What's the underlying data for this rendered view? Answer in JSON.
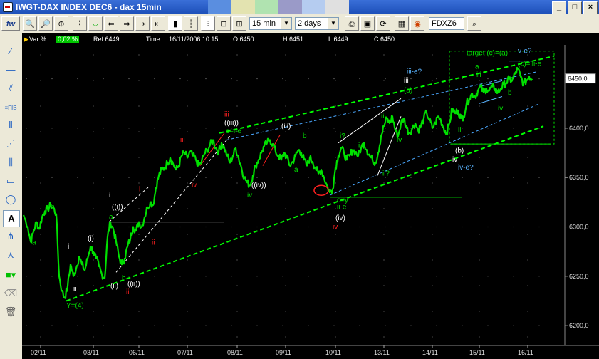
{
  "window": {
    "title": "IWGT-DAX INDEX DEC6 - dax 15min"
  },
  "title_swatches": [
    "#5a8ee0",
    "#e3e3b0",
    "#b0e3b0",
    "#9a9ac8",
    "#b5ccf0",
    "#e0e0e0"
  ],
  "toolbar": {
    "interval": "15 min",
    "range": "2 days",
    "symbol": "FDXZ6",
    "fw_label": "fw"
  },
  "infobar": {
    "var_label": "Var %:",
    "var_value": "0,02 %",
    "ref_label": "Ref:6449",
    "time_label": "Time:",
    "time_value": "16/11/2006 10:15",
    "open": "O:6450",
    "high": "H:6451",
    "low": "L:6449",
    "close": "C:6450"
  },
  "chart_data": {
    "type": "line",
    "instrument": "DAX INDEX DEC6 15min",
    "yticks": [
      "6200,0",
      "6250,0",
      "6300,0",
      "6350,0",
      "6400,0",
      "6450,0"
    ],
    "ytick_values": [
      6200,
      6250,
      6300,
      6350,
      6400,
      6450
    ],
    "ylim": [
      6190,
      6480
    ],
    "xticks": [
      "02/11",
      "03/11",
      "06/11",
      "07/11",
      "08/11",
      "09/11",
      "10/11",
      "13/11",
      "14/11",
      "15/11",
      "16/11"
    ],
    "last_value": "6450,0",
    "series_color": "#00e000",
    "price_path": [
      [
        0,
        6312
      ],
      [
        6,
        6300
      ],
      [
        10,
        6285
      ],
      [
        14,
        6295
      ],
      [
        18,
        6305
      ],
      [
        22,
        6298
      ],
      [
        26,
        6310
      ],
      [
        30,
        6316
      ],
      [
        34,
        6318
      ],
      [
        38,
        6322
      ],
      [
        42,
        6319
      ],
      [
        46,
        6313
      ],
      [
        50,
        6250
      ],
      [
        54,
        6235
      ],
      [
        58,
        6228
      ],
      [
        62,
        6240
      ],
      [
        66,
        6262
      ],
      [
        70,
        6250
      ],
      [
        74,
        6258
      ],
      [
        78,
        6270
      ],
      [
        82,
        6262
      ],
      [
        86,
        6256
      ],
      [
        90,
        6268
      ],
      [
        94,
        6280
      ],
      [
        98,
        6275
      ],
      [
        102,
        6268
      ],
      [
        106,
        6260
      ],
      [
        110,
        6252
      ],
      [
        114,
        6248
      ],
      [
        118,
        6290
      ],
      [
        122,
        6305
      ],
      [
        126,
        6298
      ],
      [
        130,
        6285
      ],
      [
        134,
        6270
      ],
      [
        138,
        6262
      ],
      [
        142,
        6268
      ],
      [
        146,
        6280
      ],
      [
        150,
        6288
      ],
      [
        154,
        6300
      ],
      [
        158,
        6296
      ],
      [
        162,
        6305
      ],
      [
        166,
        6300
      ],
      [
        170,
        6310
      ],
      [
        174,
        6320
      ],
      [
        178,
        6325
      ],
      [
        182,
        6322
      ],
      [
        186,
        6340
      ],
      [
        190,
        6352
      ],
      [
        194,
        6358
      ],
      [
        198,
        6360
      ],
      [
        202,
        6365
      ],
      [
        206,
        6370
      ],
      [
        210,
        6364
      ],
      [
        214,
        6358
      ],
      [
        218,
        6362
      ],
      [
        222,
        6372
      ],
      [
        226,
        6375
      ],
      [
        230,
        6370
      ],
      [
        234,
        6376
      ],
      [
        238,
        6372
      ],
      [
        242,
        6368
      ],
      [
        246,
        6362
      ],
      [
        250,
        6366
      ],
      [
        254,
        6374
      ],
      [
        258,
        6378
      ],
      [
        262,
        6383
      ],
      [
        266,
        6388
      ],
      [
        270,
        6380
      ],
      [
        274,
        6376
      ],
      [
        278,
        6385
      ],
      [
        282,
        6380
      ],
      [
        286,
        6372
      ],
      [
        290,
        6365
      ],
      [
        294,
        6372
      ],
      [
        298,
        6380
      ],
      [
        302,
        6370
      ],
      [
        306,
        6360
      ],
      [
        310,
        6350
      ],
      [
        314,
        6345
      ],
      [
        318,
        6342
      ],
      [
        322,
        6352
      ],
      [
        326,
        6362
      ],
      [
        330,
        6368
      ],
      [
        334,
        6375
      ],
      [
        338,
        6382
      ],
      [
        342,
        6385
      ],
      [
        346,
        6388
      ],
      [
        350,
        6384
      ],
      [
        354,
        6376
      ],
      [
        358,
        6372
      ],
      [
        362,
        6368
      ],
      [
        366,
        6375
      ],
      [
        370,
        6370
      ],
      [
        374,
        6362
      ],
      [
        378,
        6366
      ],
      [
        382,
        6372
      ],
      [
        386,
        6378
      ],
      [
        390,
        6375
      ],
      [
        394,
        6368
      ],
      [
        398,
        6362
      ],
      [
        402,
        6370
      ],
      [
        406,
        6366
      ],
      [
        410,
        6360
      ],
      [
        414,
        6354
      ],
      [
        418,
        6358
      ],
      [
        422,
        6350
      ],
      [
        426,
        6342
      ],
      [
        430,
        6335
      ],
      [
        434,
        6338
      ],
      [
        438,
        6360
      ],
      [
        442,
        6372
      ],
      [
        446,
        6380
      ],
      [
        450,
        6375
      ],
      [
        454,
        6368
      ],
      [
        458,
        6372
      ],
      [
        462,
        6378
      ],
      [
        466,
        6376
      ],
      [
        470,
        6372
      ],
      [
        474,
        6380
      ],
      [
        478,
        6385
      ],
      [
        482,
        6378
      ],
      [
        486,
        6372
      ],
      [
        490,
        6368
      ],
      [
        494,
        6365
      ],
      [
        498,
        6375
      ],
      [
        502,
        6392
      ],
      [
        506,
        6402
      ],
      [
        510,
        6410
      ],
      [
        514,
        6405
      ],
      [
        518,
        6412
      ],
      [
        522,
        6398
      ],
      [
        526,
        6392
      ],
      [
        530,
        6405
      ],
      [
        534,
        6410
      ],
      [
        538,
        6400
      ],
      [
        542,
        6395
      ],
      [
        546,
        6400
      ],
      [
        550,
        6405
      ],
      [
        554,
        6398
      ],
      [
        558,
        6402
      ],
      [
        562,
        6410
      ],
      [
        566,
        6416
      ],
      [
        570,
        6408
      ],
      [
        574,
        6400
      ],
      [
        578,
        6405
      ],
      [
        582,
        6412
      ],
      [
        586,
        6408
      ],
      [
        590,
        6400
      ],
      [
        594,
        6395
      ],
      [
        598,
        6405
      ],
      [
        602,
        6420
      ],
      [
        606,
        6415
      ],
      [
        610,
        6418
      ],
      [
        614,
        6410
      ],
      [
        618,
        6412
      ],
      [
        622,
        6425
      ],
      [
        626,
        6430
      ],
      [
        630,
        6435
      ],
      [
        634,
        6432
      ],
      [
        638,
        6438
      ],
      [
        642,
        6442
      ],
      [
        646,
        6436
      ],
      [
        650,
        6440
      ],
      [
        654,
        6438
      ],
      [
        658,
        6442
      ],
      [
        662,
        6440
      ],
      [
        666,
        6436
      ],
      [
        670,
        6440
      ],
      [
        674,
        6444
      ],
      [
        678,
        6446
      ],
      [
        682,
        6450
      ],
      [
        686,
        6448
      ],
      [
        690,
        6455
      ],
      [
        694,
        6460
      ],
      [
        698,
        6452
      ],
      [
        702,
        6445
      ],
      [
        706,
        6448
      ],
      [
        710,
        6452
      ],
      [
        714,
        6450
      ]
    ],
    "annotations": [
      {
        "text": "b",
        "color": "#00e000",
        "x": 38,
        "y": 6318
      },
      {
        "text": "a",
        "color": "#00e000",
        "x": 12,
        "y": 6282
      },
      {
        "text": "i",
        "color": "#ffffff",
        "x": 62,
        "y": 6278
      },
      {
        "text": "ii",
        "color": "#ffffff",
        "x": 70,
        "y": 6235
      },
      {
        "text": "Y=(4)",
        "color": "#00e000",
        "x": 60,
        "y": 6218
      },
      {
        "text": "(i)",
        "color": "#ffffff",
        "x": 90,
        "y": 6286
      },
      {
        "text": "(ii)",
        "color": "#ffffff",
        "x": 122,
        "y": 6238
      },
      {
        "text": "i",
        "color": "#ffffff",
        "x": 120,
        "y": 6330
      },
      {
        "text": "((i))",
        "color": "#ffffff",
        "x": 124,
        "y": 6318
      },
      {
        "text": "a",
        "color": "#00e000",
        "x": 120,
        "y": 6308
      },
      {
        "text": "ii",
        "color": "#ff2020",
        "x": 180,
        "y": 6282
      },
      {
        "text": "i",
        "color": "#ff2020",
        "x": 162,
        "y": 6336
      },
      {
        "text": "((ii))",
        "color": "#ffffff",
        "x": 146,
        "y": 6240
      },
      {
        "text": "b",
        "color": "#00e000",
        "x": 138,
        "y": 6246
      },
      {
        "text": "ii",
        "color": "#ff2020",
        "x": 144,
        "y": 6232
      },
      {
        "text": "iii",
        "color": "#ff2020",
        "x": 220,
        "y": 6386
      },
      {
        "text": "iv",
        "color": "#ff2020",
        "x": 236,
        "y": 6340
      },
      {
        "text": "iii",
        "color": "#ff2020",
        "x": 282,
        "y": 6412
      },
      {
        "text": "((iii))",
        "color": "#ffffff",
        "x": 282,
        "y": 6403
      },
      {
        "text": "c=i-e",
        "color": "#00e000",
        "x": 284,
        "y": 6395
      },
      {
        "text": "((iv))",
        "color": "#ffffff",
        "x": 320,
        "y": 6340
      },
      {
        "text": "iv",
        "color": "#00e000",
        "x": 314,
        "y": 6330
      },
      {
        "text": "(iii)",
        "color": "#ffffff",
        "x": 362,
        "y": 6400
      },
      {
        "text": "b",
        "color": "#00e000",
        "x": 392,
        "y": 6390
      },
      {
        "text": "a",
        "color": "#00e000",
        "x": 380,
        "y": 6356
      },
      {
        "text": "i?",
        "color": "#00e000",
        "x": 444,
        "y": 6390
      },
      {
        "text": "c=y",
        "color": "#00e000",
        "x": 440,
        "y": 6325
      },
      {
        "text": "ii-e",
        "color": "#00e000",
        "x": 440,
        "y": 6318
      },
      {
        "text": "(iv)",
        "color": "#ffffff",
        "x": 438,
        "y": 6307
      },
      {
        "text": "iv",
        "color": "#ff2020",
        "x": 434,
        "y": 6298
      },
      {
        "text": "i",
        "color": "#00e000",
        "x": 470,
        "y": 6380
      },
      {
        "text": "ii?",
        "color": "#00e000",
        "x": 504,
        "y": 6352
      },
      {
        "text": "iii",
        "color": "#00e000",
        "x": 502,
        "y": 6410
      },
      {
        "text": "iii-e?",
        "color": "#5ab4ff",
        "x": 538,
        "y": 6455
      },
      {
        "text": "iii",
        "color": "#ffffff",
        "x": 534,
        "y": 6446
      },
      {
        "text": "(a)",
        "color": "#00e000",
        "x": 534,
        "y": 6436
      },
      {
        "text": "iv",
        "color": "#00e000",
        "x": 524,
        "y": 6386
      },
      {
        "text": "ii",
        "color": "#00e000",
        "x": 610,
        "y": 6396
      },
      {
        "text": "(b)",
        "color": "#ffffff",
        "x": 606,
        "y": 6375
      },
      {
        "text": "iv",
        "color": "#ffffff",
        "x": 602,
        "y": 6366
      },
      {
        "text": "iv-e?",
        "color": "#5ab4ff",
        "x": 610,
        "y": 6358
      },
      {
        "text": "a",
        "color": "#00e000",
        "x": 634,
        "y": 6460
      },
      {
        "text": "iii",
        "color": "#00e000",
        "x": 636,
        "y": 6452
      },
      {
        "text": "iv",
        "color": "#00e000",
        "x": 666,
        "y": 6418
      },
      {
        "text": "target (c)=(a)",
        "color": "#00e000",
        "x": 622,
        "y": 6474
      },
      {
        "text": "v-e?",
        "color": "#5ab4ff",
        "x": 694,
        "y": 6476
      },
      {
        "text": "(c)=iii-e",
        "color": "#00e000",
        "x": 694,
        "y": 6463
      },
      {
        "text": "b",
        "color": "#00e000",
        "x": 680,
        "y": 6434
      }
    ],
    "trendlines": [
      {
        "color": "#00ff00",
        "dash": "6,4",
        "width": 2,
        "p1": [
          60,
          6225
        ],
        "p2": [
          730,
          6402
        ]
      },
      {
        "color": "#00ff00",
        "dash": "6,4",
        "width": 2,
        "p1": [
          275,
          6395
        ],
        "p2": [
          745,
          6473
        ]
      },
      {
        "color": "#4aa8ff",
        "dash": "4,3",
        "width": 1,
        "p1": [
          430,
          6332
        ],
        "p2": [
          725,
          6425
        ]
      },
      {
        "color": "#4aa8ff",
        "dash": "4,3",
        "width": 1,
        "p1": [
          285,
          6388
        ],
        "p2": [
          720,
          6457
        ]
      },
      {
        "color": "#ffffff",
        "dash": "4,3",
        "width": 1,
        "p1": [
          130,
          6254
        ],
        "p2": [
          290,
          6392
        ]
      },
      {
        "color": "#ffffff",
        "dash": "4,3",
        "width": 1,
        "p1": [
          120,
          6305
        ],
        "p2": [
          175,
          6340
        ]
      },
      {
        "color": "#ffffff",
        "dash": "",
        "width": 1,
        "p1": [
          120,
          6305
        ],
        "p2": [
          282,
          6305
        ]
      },
      {
        "color": "#ffffff",
        "dash": "",
        "width": 1,
        "p1": [
          442,
          6385
        ],
        "p2": [
          530,
          6430
        ]
      },
      {
        "color": "#ffffff",
        "dash": "",
        "width": 1,
        "p1": [
          497,
          6352
        ],
        "p2": [
          530,
          6412
        ]
      },
      {
        "color": "#00e000",
        "dash": "",
        "width": 1,
        "p1": [
          60,
          6225
        ],
        "p2": [
          310,
          6225
        ]
      },
      {
        "color": "#00e000",
        "dash": "",
        "width": 1,
        "p1": [
          430,
          6330
        ],
        "p2": [
          615,
          6330
        ]
      },
      {
        "color": "#00e000",
        "dash": "",
        "width": 1,
        "p1": [
          600,
          6384
        ],
        "p2": [
          740,
          6384
        ]
      },
      {
        "color": "#ff2020",
        "dash": "",
        "width": 1,
        "p1": [
          248,
          6362
        ],
        "p2": [
          282,
          6395
        ]
      },
      {
        "color": "#ff2020",
        "dash": "",
        "width": 1,
        "p1": [
          336,
          6362
        ],
        "p2": [
          360,
          6393
        ]
      },
      {
        "color": "#5ab4ff",
        "dash": "",
        "width": 1,
        "p1": [
          682,
          6468
        ],
        "p2": [
          714,
          6468
        ]
      },
      {
        "color": "#5ab4ff",
        "dash": "",
        "width": 1,
        "p1": [
          640,
          6442
        ],
        "p2": [
          672,
          6448
        ]
      },
      {
        "color": "#5ab4ff",
        "dash": "",
        "width": 1,
        "p1": [
          640,
          6425
        ],
        "p2": [
          672,
          6432
        ]
      }
    ],
    "target_box": {
      "color": "#00e000",
      "x1": 598,
      "x2": 745,
      "y1": 6384,
      "y2": 6478
    },
    "ellipse": {
      "color": "#ff2020",
      "cx": 418,
      "cy": 6337,
      "rx": 10,
      "ry": 7
    }
  }
}
